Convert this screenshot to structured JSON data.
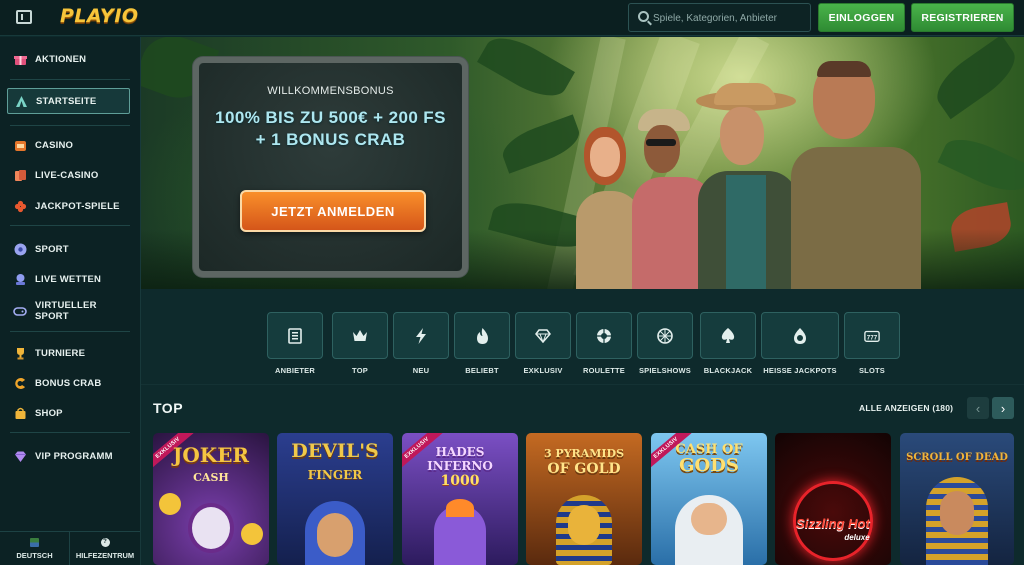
{
  "header": {
    "logo": "PLAYIO",
    "search_placeholder": "Spiele, Kategorien, Anbieter",
    "login_label": "EINLOGGEN",
    "register_label": "REGISTRIEREN"
  },
  "sidebar": {
    "items": [
      {
        "label": "AKTIONEN",
        "icon": "gift-icon"
      },
      {
        "label": "STARTSEITE",
        "icon": "home-tent-icon",
        "active": true
      },
      {
        "label": "CASINO",
        "icon": "slot-machine-icon"
      },
      {
        "label": "LIVE-CASINO",
        "icon": "cards-icon"
      },
      {
        "label": "JACKPOT-SPIELE",
        "icon": "clover-icon"
      },
      {
        "label": "SPORT",
        "icon": "soccer-ball-icon"
      },
      {
        "label": "LIVE WETTEN",
        "icon": "live-bet-icon"
      },
      {
        "label": "VIRTUELLER SPORT",
        "icon": "gamepad-icon"
      },
      {
        "label": "TURNIERE",
        "icon": "trophy-icon"
      },
      {
        "label": "BONUS CRAB",
        "icon": "crab-claw-icon"
      },
      {
        "label": "SHOP",
        "icon": "shopping-bag-icon"
      },
      {
        "label": "VIP PROGRAMM",
        "icon": "diamond-icon"
      }
    ],
    "language_label": "DEUTSCH",
    "help_label": "HILFEZENTRUM"
  },
  "hero": {
    "eyebrow": "WILLKOMMENSBONUS",
    "title": "100% BIS ZU 500€ + 200 FS + 1 BONUS CRAB",
    "cta_label": "JETZT ANMELDEN"
  },
  "categories": [
    {
      "label": "ANBIETER",
      "icon": "provider-book-icon"
    },
    {
      "label": "TOP",
      "icon": "crown-icon"
    },
    {
      "label": "NEU",
      "icon": "lightning-icon"
    },
    {
      "label": "BELIEBT",
      "icon": "flame-icon"
    },
    {
      "label": "EXKLUSIV",
      "icon": "gem-icon"
    },
    {
      "label": "ROULETTE",
      "icon": "roulette-icon"
    },
    {
      "label": "SPIELSHOWS",
      "icon": "wheel-icon"
    },
    {
      "label": "BLACKJACK",
      "icon": "spade-icon"
    },
    {
      "label": "HEISSE JACKPOTS",
      "icon": "hot-jackpot-icon"
    },
    {
      "label": "SLOTS",
      "icon": "slot-777-icon"
    }
  ],
  "top_section": {
    "title": "TOP",
    "view_all_label": "ALLE ANZEIGEN (180)"
  },
  "games": [
    {
      "name": "JOKER",
      "sub": "CASH",
      "badge": "EXKLUSIV"
    },
    {
      "name": "DEVIL'S",
      "sub": "FINGER",
      "badge": ""
    },
    {
      "name": "HADES INFERNO",
      "sub": "1000",
      "badge": "EXKLUSIV"
    },
    {
      "name": "3 PYRAMIDS",
      "sub": "OF GOLD",
      "badge": ""
    },
    {
      "name": "CASH OF",
      "sub": "GODS",
      "badge": "EXKLUSIV"
    },
    {
      "name": "Sizzling Hot",
      "sub": "deluxe",
      "badge": ""
    },
    {
      "name": "SCROLL OF DEAD",
      "sub": "",
      "badge": ""
    }
  ],
  "colors": {
    "accent_green": "#3fa542",
    "cta_orange": "#f0781f",
    "background": "#0e2a2c",
    "logo_gold": "#f7c53a"
  }
}
